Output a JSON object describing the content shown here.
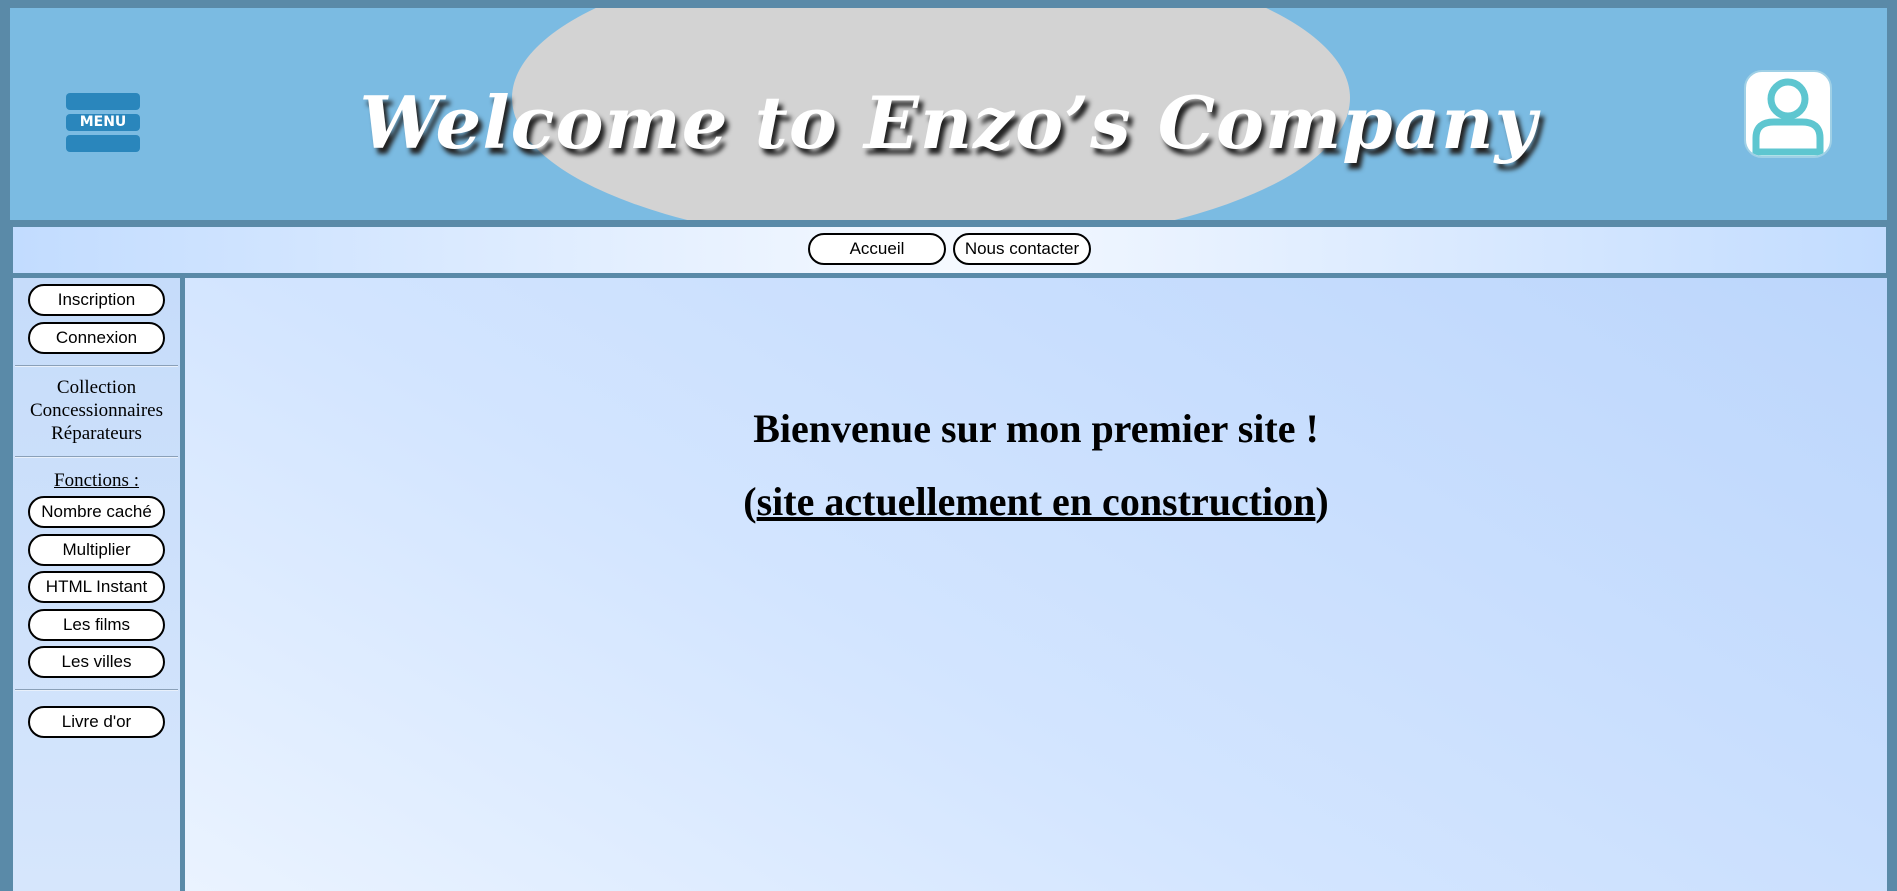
{
  "header": {
    "title": "Welcome to Enzo’s Company",
    "menu_label": "MENU"
  },
  "topnav": {
    "items": [
      {
        "label": "Accueil"
      },
      {
        "label": "Nous contacter"
      }
    ]
  },
  "sidebar": {
    "auth": [
      {
        "label": "Inscription"
      },
      {
        "label": "Connexion"
      }
    ],
    "links": [
      "Collection",
      "Concessionnaires",
      "Réparateurs"
    ],
    "functions_heading": "Fonctions :",
    "functions": [
      {
        "label": "Nombre caché"
      },
      {
        "label": "Multiplier"
      },
      {
        "label": "HTML Instant"
      },
      {
        "label": "Les films"
      },
      {
        "label": "Les villes"
      }
    ],
    "guestbook": {
      "label": "Livre d'or"
    }
  },
  "main": {
    "welcome": "Bienvenue sur mon premier site !",
    "status_open": "(",
    "status": "site actuellement en construction",
    "status_close": ")"
  },
  "colors": {
    "header_bg": "#7bbbe2",
    "oval": "#d3d3d3",
    "menu_bar": "#2a86bc",
    "frame": "#5a8aa8",
    "profile_icon": "#5ec6d0"
  },
  "icons": {
    "menu": "hamburger-menu-icon",
    "profile": "user-profile-icon"
  }
}
